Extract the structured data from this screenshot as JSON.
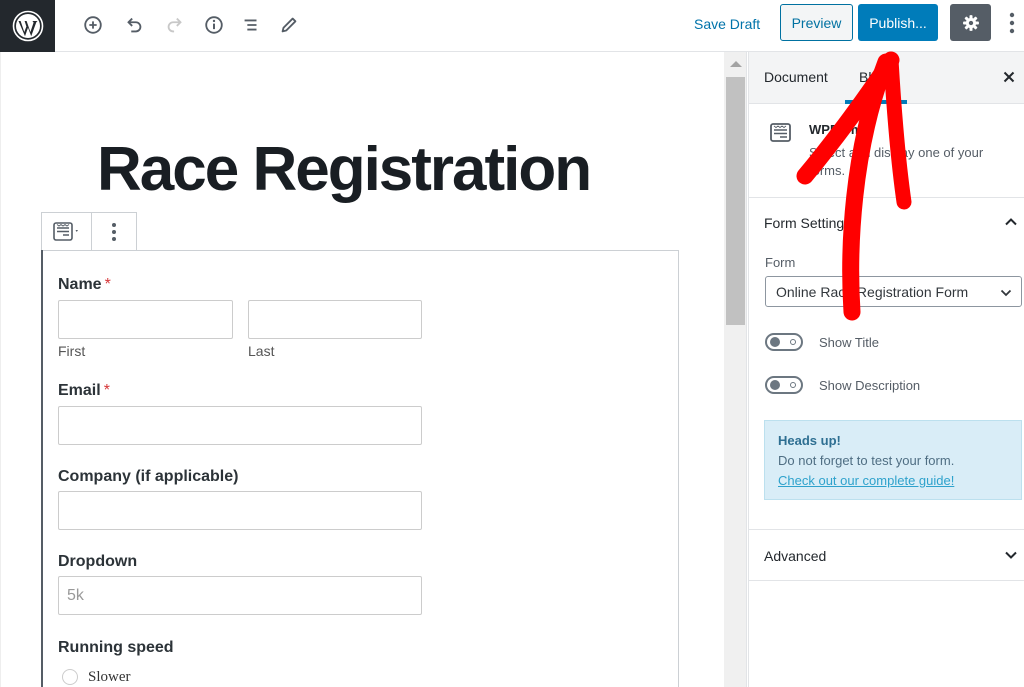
{
  "toolbar": {
    "icons": [
      "wordpress-logo",
      "add-block",
      "undo",
      "redo",
      "content-info",
      "block-navigation",
      "edit-tools"
    ],
    "save_draft_label": "Save Draft",
    "preview_label": "Preview",
    "publish_label": "Publish...",
    "colors": {
      "publish_bg": "#007cba",
      "settings_bg": "#555d66",
      "logo_bg": "#23282d"
    }
  },
  "editor": {
    "post_title": "Race Registration",
    "form": {
      "fields": [
        {
          "label": "Name",
          "required": true,
          "required_mark": "*",
          "sublabels": [
            "First",
            "Last"
          ]
        },
        {
          "label": "Email",
          "required": true,
          "required_mark": "*"
        },
        {
          "label": "Company (if applicable)",
          "required": false
        },
        {
          "label": "Dropdown",
          "required": false,
          "value": "5k"
        },
        {
          "label": "Running speed",
          "required": false,
          "options": [
            "Slower"
          ]
        }
      ]
    }
  },
  "sidebar": {
    "tabs": [
      {
        "label": "Document",
        "active": false
      },
      {
        "label": "Block",
        "active": true
      }
    ],
    "close_icon": "×",
    "block_card": {
      "title": "WPForms",
      "description": "Select and display one of your forms."
    },
    "form_settings": {
      "title": "Form Settings",
      "expanded": true,
      "form_label": "Form",
      "form_selected": "Online Race Registration Form",
      "toggles": [
        {
          "label": "Show Title",
          "on": false
        },
        {
          "label": "Show Description",
          "on": false
        }
      ],
      "notice": {
        "title": "Heads up!",
        "text": "Do not forget to test your form.",
        "link": "Check out our complete guide!"
      }
    },
    "advanced": {
      "title": "Advanced",
      "expanded": false
    }
  },
  "annotation": {
    "type": "red-arrow",
    "points_to": "publish-button",
    "color": "#ff0000"
  }
}
